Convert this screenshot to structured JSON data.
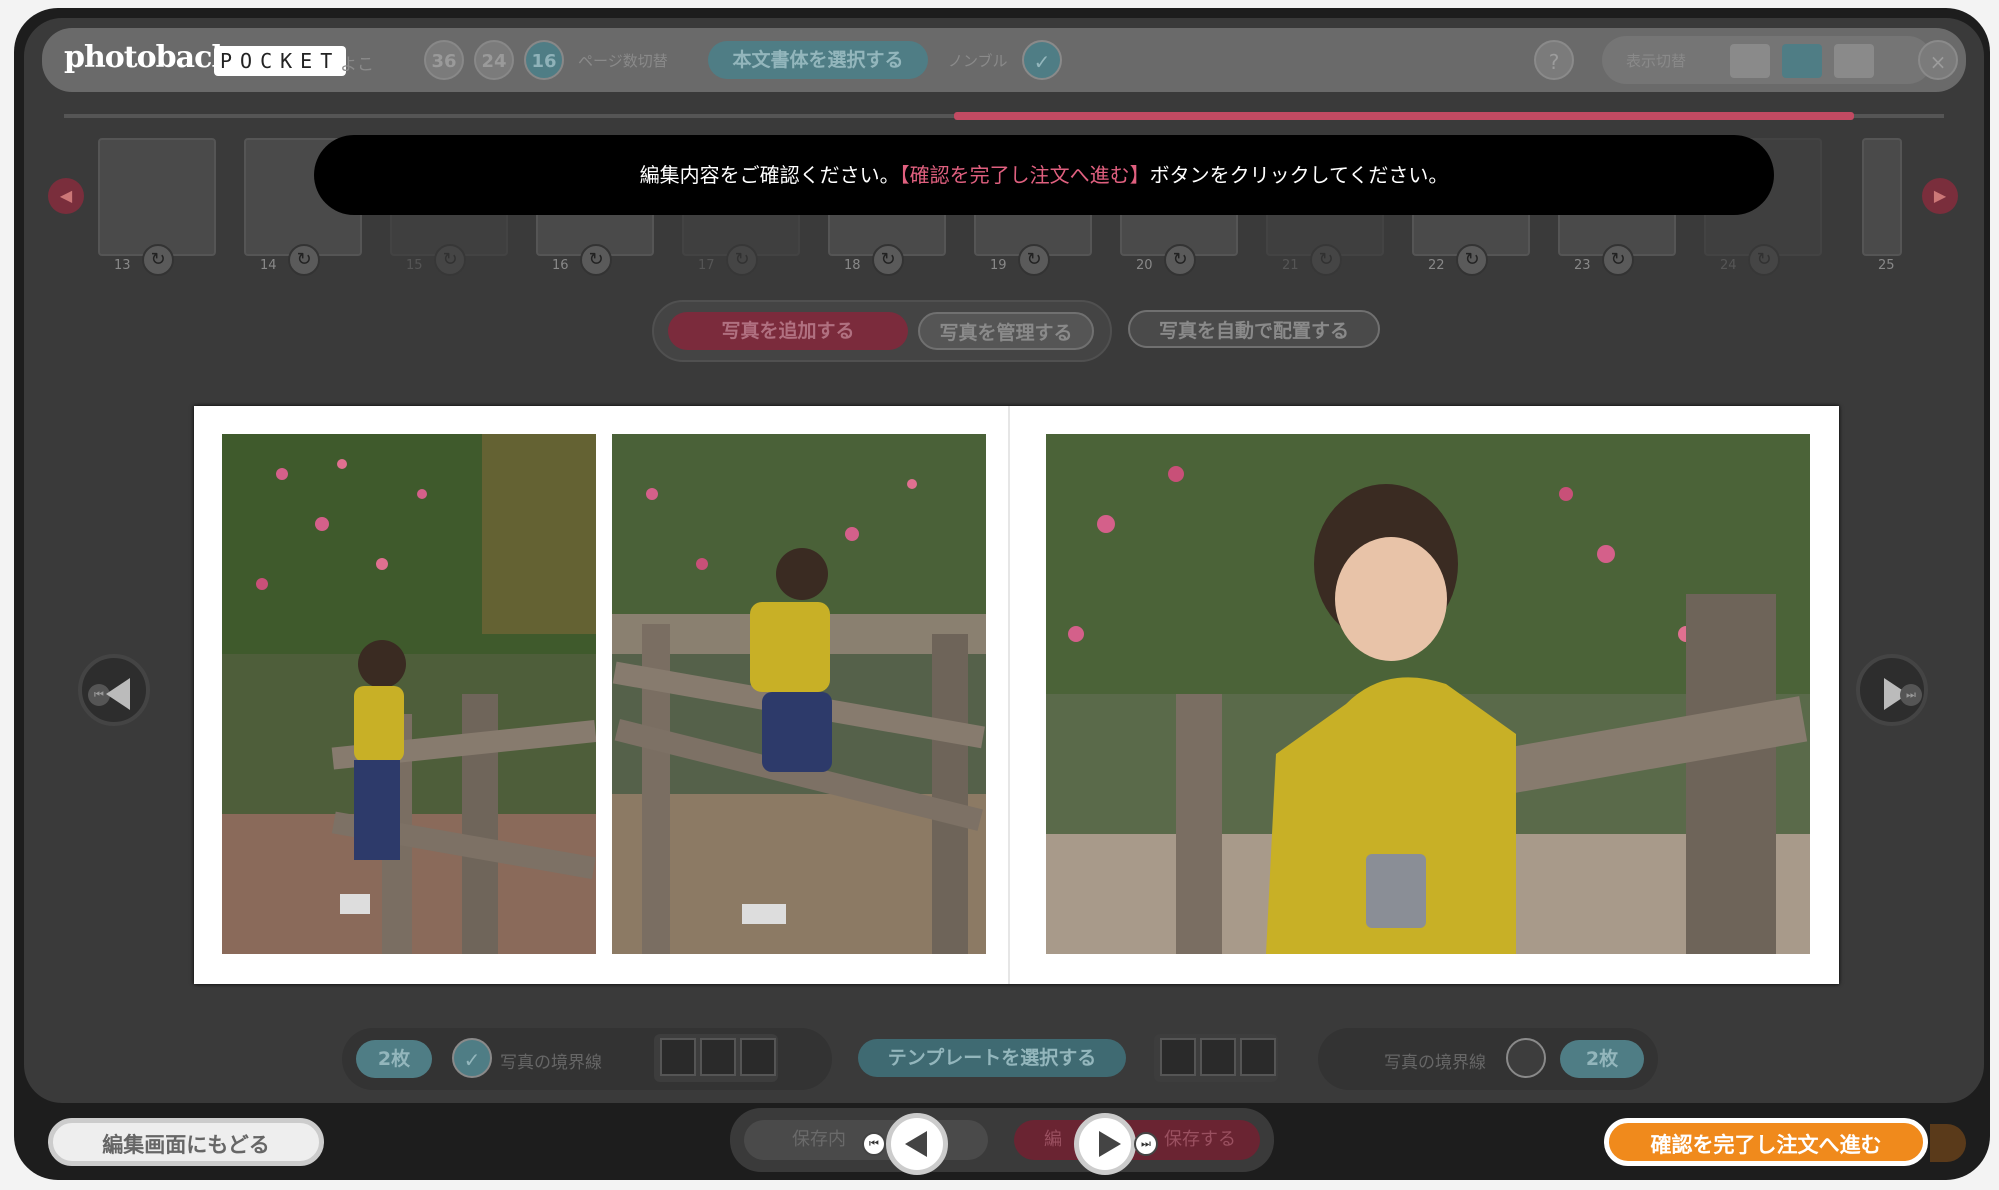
{
  "app": {
    "logo_text": "photoback",
    "logo_suffix": "POCKET",
    "yoko": "よこ"
  },
  "pages": {
    "options": [
      "36",
      "24",
      "16"
    ],
    "selected": "16",
    "label": "ページ数切替"
  },
  "font_button": "本文書体を選択する",
  "style_label": "ノンブル",
  "view_switch_label": "表示切替",
  "help": "?",
  "close": "×",
  "thumbnails": [
    {
      "num": "13",
      "faded": false
    },
    {
      "num": "14",
      "faded": false
    },
    {
      "num": "15",
      "faded": true
    },
    {
      "num": "16",
      "faded": false
    },
    {
      "num": "17",
      "faded": true
    },
    {
      "num": "18",
      "faded": false
    },
    {
      "num": "19",
      "faded": false
    },
    {
      "num": "20",
      "faded": false
    },
    {
      "num": "21",
      "faded": true
    },
    {
      "num": "22",
      "faded": false
    },
    {
      "num": "23",
      "faded": false
    },
    {
      "num": "24",
      "faded": true
    },
    {
      "num": "25",
      "faded": false
    }
  ],
  "toast": {
    "before": "編集内容をご確認ください。",
    "highlight": "【確認を完了し注文へ進む】",
    "after": "ボタンをクリックしてください。"
  },
  "photo_actions": {
    "add": "写真を追加する",
    "manage": "写真を管理する",
    "auto": "写真を自動で配置する"
  },
  "left_controls": {
    "count": "2枚",
    "border": "写真の境界線"
  },
  "template_button": "テンプレートを選択する",
  "right_controls": {
    "border": "写真の境界線",
    "count": "2枚"
  },
  "footer": {
    "back": "編集画面にもどる",
    "save_left": "保存内",
    "save_right_prefix": "編",
    "save_right": "保存する",
    "confirm": "確認を完了し注文へ進む"
  }
}
